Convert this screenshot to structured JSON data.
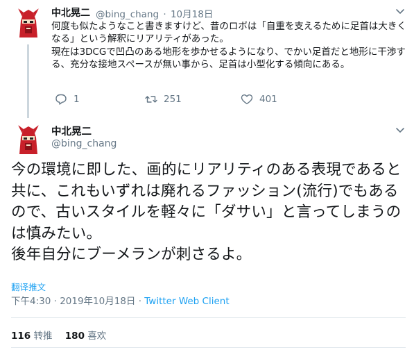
{
  "tweet1": {
    "author_name": "中北晃二",
    "handle": "@bing_chang",
    "separator": "·",
    "date": "10月18日",
    "text": "何度も似たようなこと書きますけど、昔のロボは「自重を支えるために足首は大きくなる」という解釈にリアリティがあった。\n現在は3DCGで凹凸のある地形を歩かせるようになり、でかい足首だと地形に干渉する、充分な接地スペースが無い事から、足首は小型化する傾向にある。",
    "replies": "1",
    "retweets": "251",
    "likes": "401"
  },
  "tweet2": {
    "author_name": "中北晃二",
    "handle": "@bing_chang",
    "text": "今の環境に即した、画的にリアリティのある表現であると共に、これもいずれは廃れるファッション(流行)でもあるので、古いスタイルを軽々に「ダサい」と言ってしまうのは慎みたい。\n後年自分にブーメランが刺さるよ。",
    "translate_label": "翻译推文",
    "timestamp": "下午4:30 · 2019年10月18日 · ",
    "client": "Twitter Web Client",
    "retweet_count": "116",
    "retweet_label": "转推",
    "like_count": "180",
    "like_label": "喜欢"
  },
  "colors": {
    "text": "#14171a",
    "secondary": "#657786",
    "link": "#1da1f2",
    "divider": "#e1e8ed",
    "avatar_red": "#c8202a"
  },
  "icons": [
    "avatar",
    "chevron-down-icon",
    "reply-icon",
    "retweet-icon",
    "like-icon"
  ]
}
